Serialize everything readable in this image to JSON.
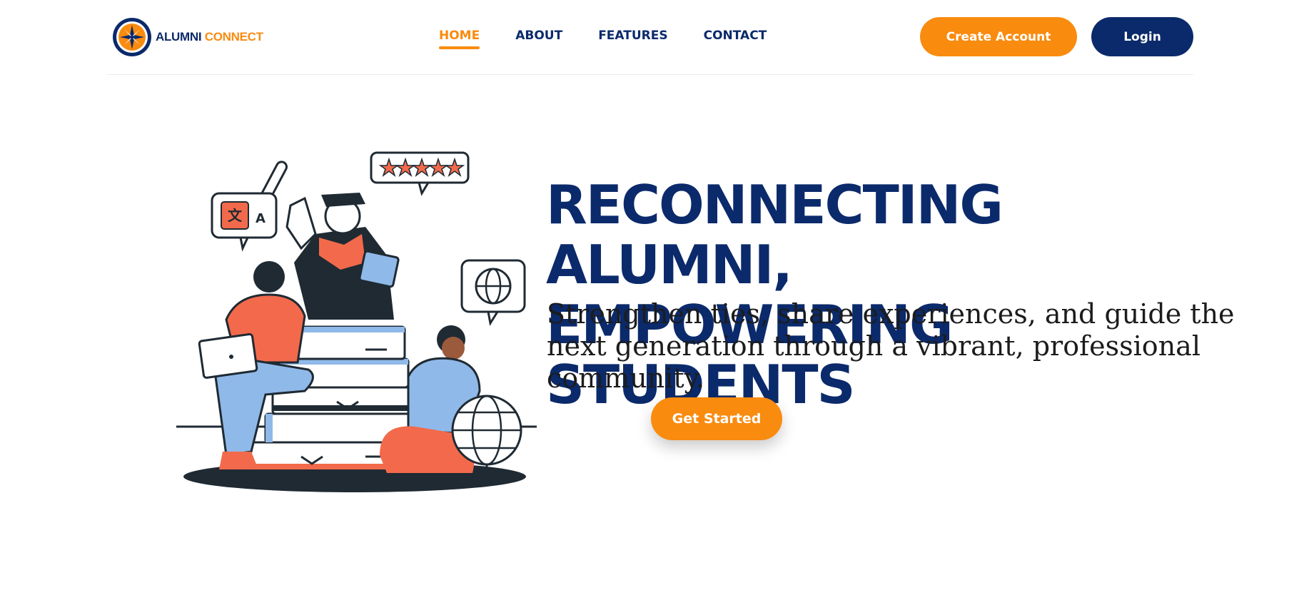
{
  "brand": {
    "name_part1": "ALUMNI",
    "name_part2": "CONNECT"
  },
  "nav": {
    "items": [
      {
        "label": "HOME",
        "active": true
      },
      {
        "label": "ABOUT",
        "active": false
      },
      {
        "label": "FEATURES",
        "active": false
      },
      {
        "label": "CONTACT",
        "active": false
      }
    ]
  },
  "actions": {
    "create_account": "Create Account",
    "login": "Login"
  },
  "hero": {
    "title_line1": "RECONNECTING ALUMNI,",
    "title_line2": "EMPOWERING STUDENTS",
    "subtitle": "Strengthen ties, share experiences, and guide the next generation through a vibrant, professional community.",
    "cta": "Get Started",
    "illustration_letters": {
      "left": "文",
      "right": "A"
    }
  },
  "colors": {
    "brand_navy": "#0b2a6b",
    "brand_orange": "#f98b0f",
    "accent_red": "#f26a4b",
    "accent_blue": "#8fb9e8",
    "ink": "#1f2a33"
  },
  "icons": [
    "compass-logo-icon",
    "translate-bubble-icon",
    "rating-stars-bubble-icon",
    "globe-bubble-icon"
  ]
}
